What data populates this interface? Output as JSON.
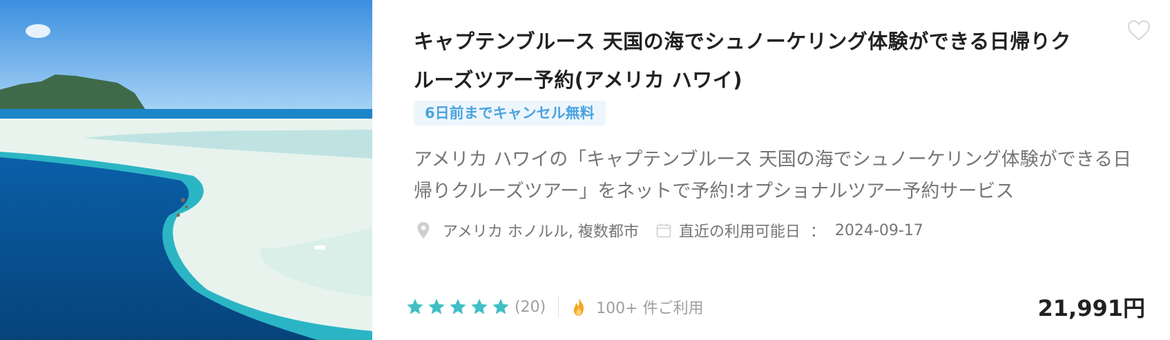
{
  "card": {
    "title": "キャプテンブルース 天国の海でシュノーケリング体験ができる日帰りクルーズツアー予約(アメリカ ハワイ)",
    "cancel_badge": "6日前までキャンセル無料",
    "description": "アメリカ ハワイの「キャプテンブルース 天国の海でシュノーケリング体験ができる日帰りクルーズツアー」をネットで予約!オプショナルツアー予約サービス",
    "location": "アメリカ ホノルル, 複数都市",
    "availability_label": "直近の利用可能日",
    "availability_separator": "：",
    "availability_date": "2024-09-17",
    "rating": 5,
    "review_count": "(20)",
    "usage": "100+ 件ご利用",
    "price": "21,991円"
  },
  "icons": {
    "favorite": "heart-outline-icon",
    "location": "map-pin-icon",
    "date": "calendar-icon",
    "rating": "star-icon",
    "popularity": "fire-icon"
  },
  "colors": {
    "star": "#3fbfc6",
    "badge_text": "#4aa3e0",
    "badge_bg": "#eef6fd",
    "fire": "#f5a623",
    "price": "#212121"
  }
}
